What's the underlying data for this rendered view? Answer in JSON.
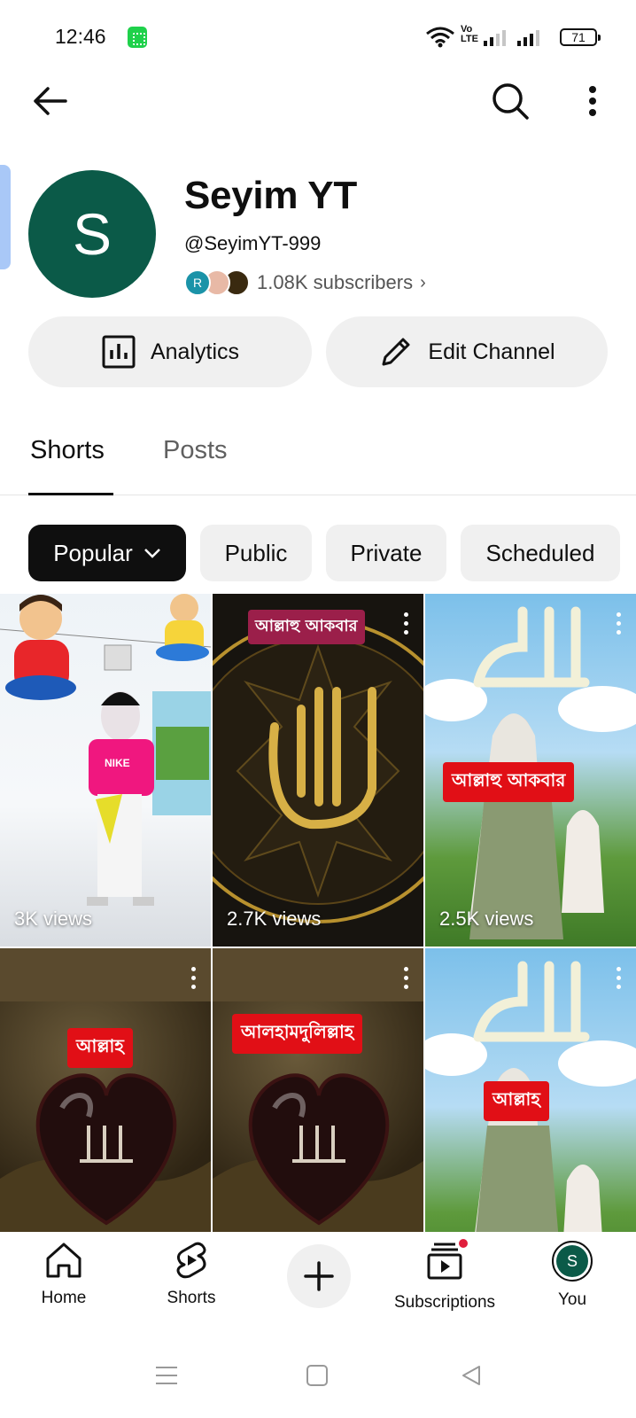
{
  "status_bar": {
    "time": "12:46",
    "volte": "Vo LTE",
    "battery": "71"
  },
  "icons": {
    "back": "arrow-left-icon",
    "search": "search-icon",
    "more": "more-vert-icon",
    "analytics": "bar-chart-icon",
    "edit": "pencil-icon",
    "chevron": "chevron-down-icon"
  },
  "channel": {
    "avatar_letter": "S",
    "name": "Seyim YT",
    "handle": "@SeyimYT-999",
    "subscriber_avatar_letter": "R",
    "subscribers": "1.08K subscribers",
    "subscribers_chevron": "›"
  },
  "actions": {
    "analytics": "Analytics",
    "edit_channel": "Edit Channel"
  },
  "tabs": [
    {
      "label": "Shorts",
      "selected": true
    },
    {
      "label": "Posts",
      "selected": false
    }
  ],
  "filters": [
    {
      "label": "Popular",
      "selected": true
    },
    {
      "label": "Public",
      "selected": false
    },
    {
      "label": "Private",
      "selected": false
    },
    {
      "label": "Scheduled",
      "selected": false
    }
  ],
  "shorts": [
    {
      "views": "3K views",
      "tag": ""
    },
    {
      "views": "2.7K views",
      "tag": "আল্লাহু আকবার"
    },
    {
      "views": "2.5K views",
      "tag": "আল্লাহু আকবার"
    },
    {
      "views": "",
      "tag": "আল্লাহ"
    },
    {
      "views": "",
      "tag": "আলহামদুলিল্লাহ"
    },
    {
      "views": "",
      "tag": "আল্লাহ"
    }
  ],
  "shirt_text": "NIKE",
  "bottom_nav": [
    {
      "label": "Home"
    },
    {
      "label": "Shorts"
    },
    {
      "label": "Subscriptions"
    },
    {
      "label": "You"
    }
  ],
  "you_avatar_letter": "S",
  "colors": {
    "avatar": "#0b5a48",
    "tag_red": "#e10f16",
    "notification": "#e01e3c"
  }
}
